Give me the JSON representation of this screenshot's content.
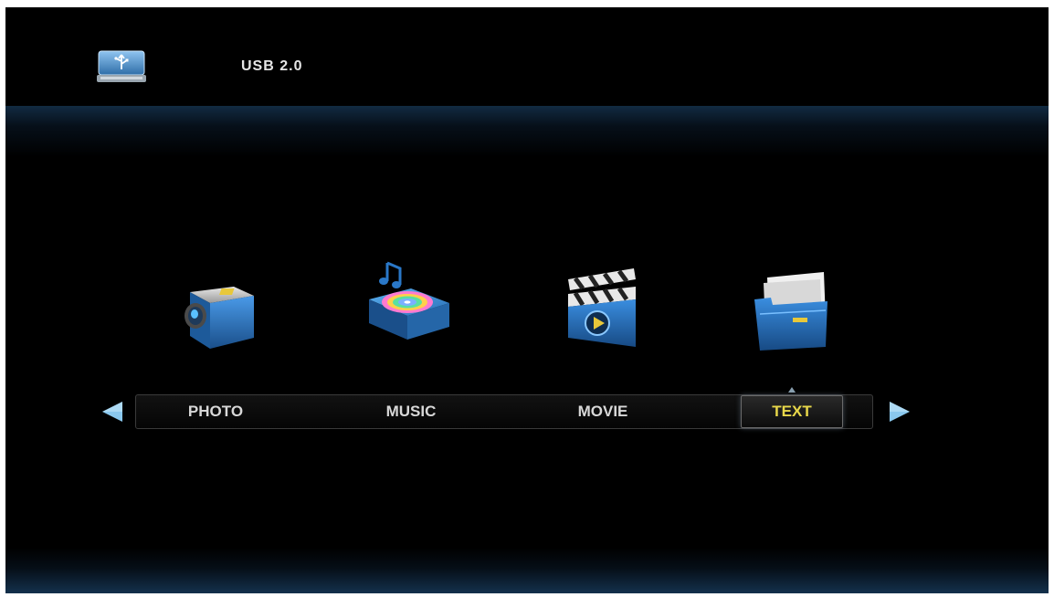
{
  "header": {
    "title": "USB 2.0",
    "icon": "usb-drive-icon"
  },
  "media": {
    "items": [
      {
        "label": "PHOTO",
        "icon": "camera-icon"
      },
      {
        "label": "MUSIC",
        "icon": "music-disc-icon"
      },
      {
        "label": "MOVIE",
        "icon": "clapperboard-icon"
      },
      {
        "label": "TEXT",
        "icon": "document-folder-icon"
      }
    ],
    "selected_label": "TEXT"
  },
  "nav": {
    "prev_icon": "arrow-left-icon",
    "next_icon": "arrow-right-icon"
  },
  "colors": {
    "background": "#000000",
    "label": "#d8d8d8",
    "selected_label": "#e8d84a",
    "accent_blue": "#2a78c8"
  }
}
